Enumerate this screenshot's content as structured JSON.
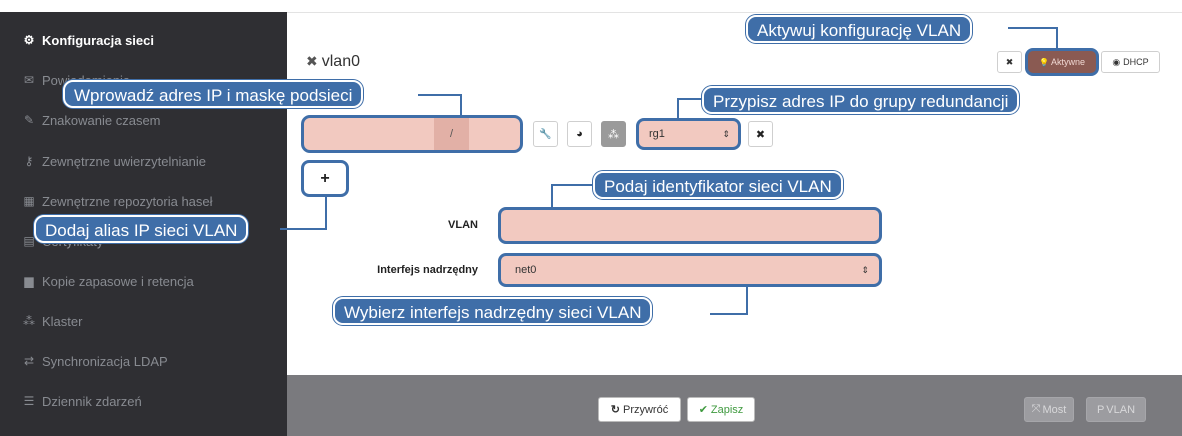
{
  "sidebar": {
    "items": [
      {
        "icon": "gears-icon",
        "glyph": "⚙",
        "label": "Konfiguracja sieci",
        "active": true
      },
      {
        "icon": "envelope-icon",
        "glyph": "✉",
        "label": "Powiadomienia"
      },
      {
        "icon": "edit-icon",
        "glyph": "✎",
        "label": "Znakowanie czasem"
      },
      {
        "icon": "key-icon",
        "glyph": "⚷",
        "label": "Zewnętrzne uwierzytelnianie"
      },
      {
        "icon": "grid-icon",
        "glyph": "▦",
        "label": "Zewnętrzne repozytoria haseł"
      },
      {
        "icon": "certificate-icon",
        "glyph": "▤",
        "label": "Certyfikaty"
      },
      {
        "icon": "archive-icon",
        "glyph": "▆",
        "label": "Kopie zapasowe i retencja"
      },
      {
        "icon": "sitemap-icon",
        "glyph": "⁂",
        "label": "Klaster"
      },
      {
        "icon": "exchange-icon",
        "glyph": "⇄",
        "label": "Synchronizacja LDAP"
      },
      {
        "icon": "list-icon",
        "glyph": "☰",
        "label": "Dziennik zdarzeń"
      }
    ]
  },
  "header": {
    "title": "vlan0",
    "close_glyph": "✖",
    "remove_glyph": "✖",
    "active_label": "Aktywne",
    "active_glyph": "💡",
    "dhcp_label": "DHCP",
    "dhcp_glyph": "◉"
  },
  "ip_row": {
    "separator": "/",
    "tools": [
      {
        "icon": "wrench-icon",
        "glyph": "🔧"
      },
      {
        "icon": "globe-icon",
        "glyph": "◕"
      },
      {
        "icon": "sitemap-icon",
        "glyph": "⁂"
      }
    ],
    "redundancy_value": "rg1",
    "remove_glyph": "✖",
    "add_glyph": "+"
  },
  "form": {
    "vlan_label": "VLAN",
    "vlan_value": "",
    "parent_label": "Interfejs nadrzędny",
    "parent_value": "net0"
  },
  "callouts": {
    "activate": "Aktywuj konfigurację VLAN",
    "ip": "Wprowadź adres IP i maskę podsieci",
    "redundancy": "Przypisz adres IP do grupy redundancji",
    "vlan_id": "Podaj identyfikator sieci VLAN",
    "alias": "Dodaj alias IP sieci VLAN",
    "parent": "Wybierz interfejs nadrzędny sieci VLAN"
  },
  "footer": {
    "revert_label": "Przywróć",
    "revert_glyph": "↻",
    "save_label": "Zapisz",
    "save_glyph": "✔",
    "most_label": "Most",
    "most_glyph": "⤧",
    "vlan_label": "VLAN",
    "vlan_glyph": "P"
  },
  "colors": {
    "callout": "#3f6ea8",
    "highlight": "#f2c9c0",
    "active_button": "#8a5a52",
    "save_green": "#3f9a3f"
  }
}
